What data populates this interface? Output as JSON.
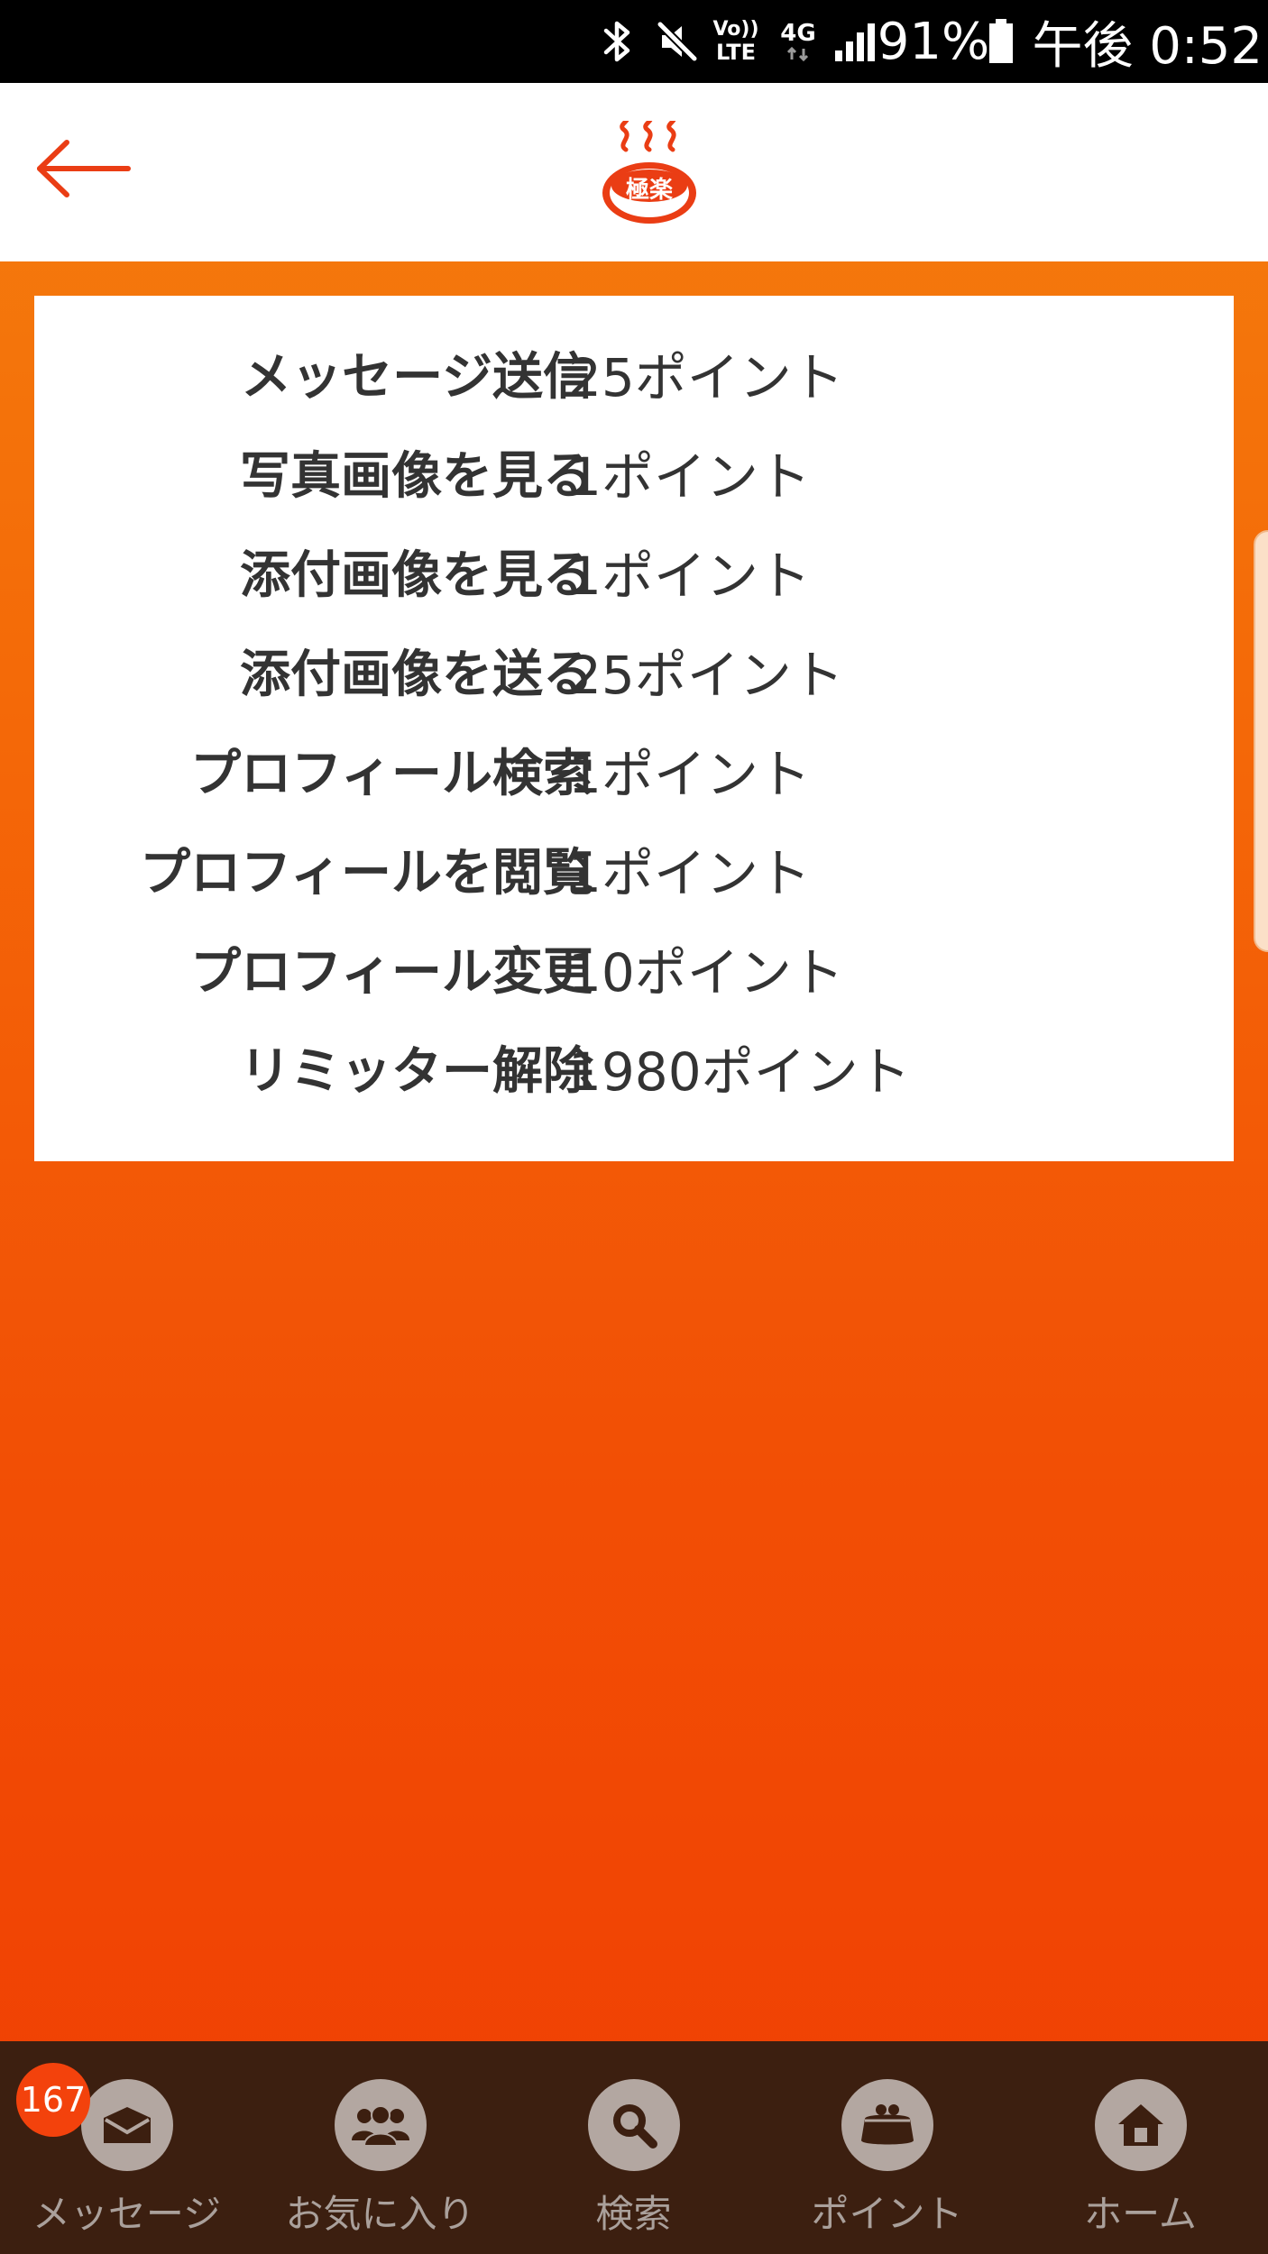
{
  "status_bar": {
    "lte_label_top": "Vo))",
    "lte_label_bottom": "LTE",
    "network_label": "4G",
    "battery_percent": "91%",
    "time": "午後 0:52",
    "icons": [
      "bluetooth-icon",
      "mute-icon",
      "volte-icon",
      "data-4g-icon",
      "signal-icon",
      "battery-icon"
    ]
  },
  "header": {
    "back_icon": "back-arrow-icon",
    "logo_text": "極楽"
  },
  "points_table": [
    {
      "label": "メッセージ送信",
      "value": "25ポイント"
    },
    {
      "label": "写真画像を見る",
      "value": "1ポイント"
    },
    {
      "label": "添付画像を見る",
      "value": "1ポイント"
    },
    {
      "label": "添付画像を送る",
      "value": "25ポイント"
    },
    {
      "label": "プロフィール検索",
      "value": "1ポイント"
    },
    {
      "label": "プロフィールを閲覧",
      "value": "1ポイント"
    },
    {
      "label": "プロフィール変更",
      "value": "10ポイント"
    },
    {
      "label": "リミッター解除",
      "value": "1980ポイント"
    }
  ],
  "bottom_nav": {
    "badge_count": "167",
    "items": [
      {
        "label": "メッセージ",
        "icon": "envelope-icon"
      },
      {
        "label": "お気に入り",
        "icon": "people-icon"
      },
      {
        "label": "検索",
        "icon": "search-icon"
      },
      {
        "label": "ポイント",
        "icon": "purse-icon"
      },
      {
        "label": "ホーム",
        "icon": "home-icon"
      }
    ]
  },
  "colors": {
    "accent": "#f0501a",
    "background_top": "#f57f0e",
    "background_bottom": "#f03e03",
    "nav_background": "#3c1f10",
    "nav_icon_circle": "#b3a7a1",
    "badge": "#f3420c"
  }
}
